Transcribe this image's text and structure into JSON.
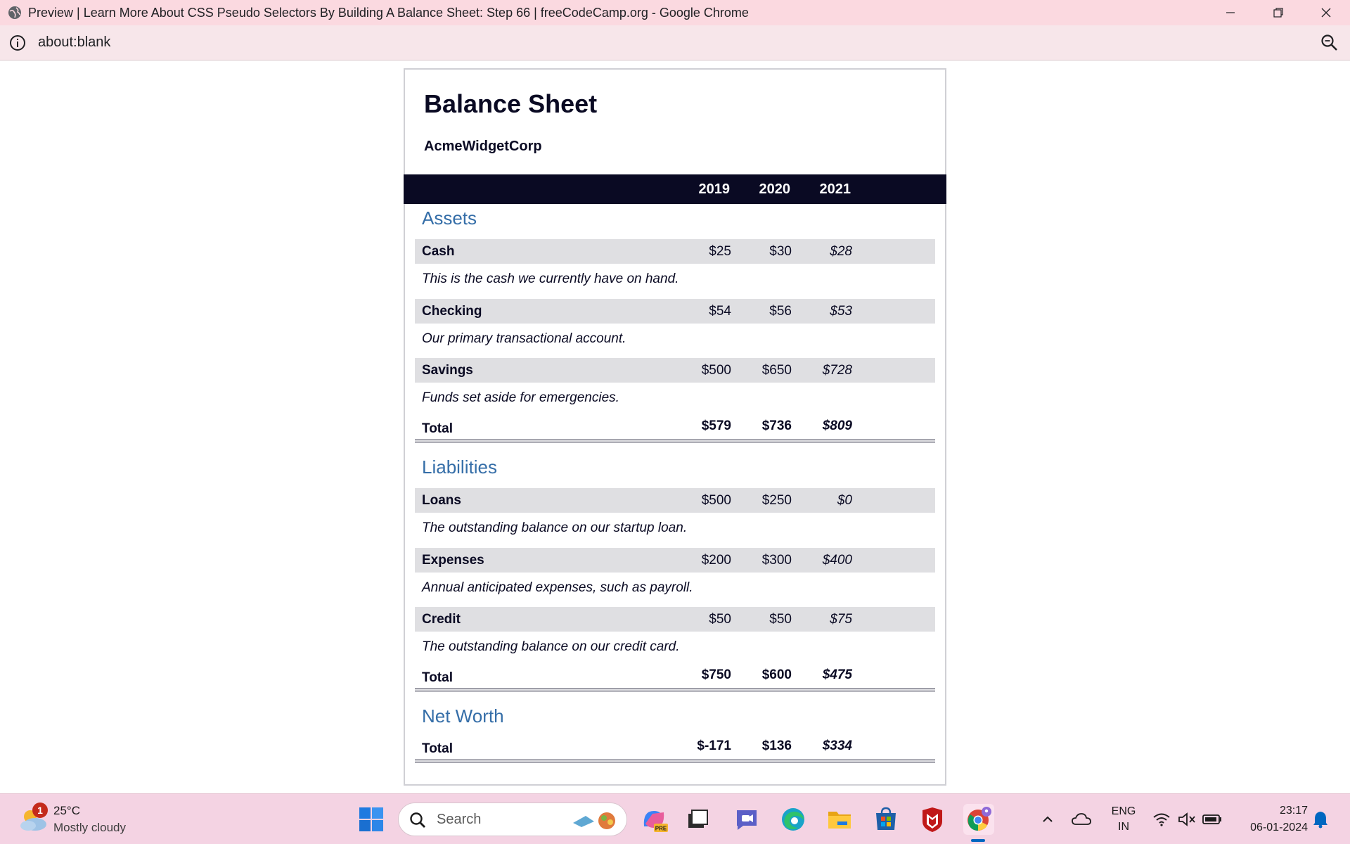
{
  "browser": {
    "window_title": "Preview | Learn More About CSS Pseudo Selectors By Building A Balance Sheet: Step 66 | freeCodeCamp.org - Google Chrome",
    "url": "about:blank"
  },
  "sheet": {
    "title": "Balance Sheet",
    "company": "AcmeWidgetCorp",
    "years": [
      "2019",
      "2020",
      "2021"
    ],
    "assets": {
      "heading": "Assets",
      "rows": [
        {
          "label": "Cash",
          "v2019": "$25",
          "v2020": "$30",
          "v2021": "$28",
          "desc": "This is the cash we currently have on hand."
        },
        {
          "label": "Checking",
          "v2019": "$54",
          "v2020": "$56",
          "v2021": "$53",
          "desc": "Our primary transactional account."
        },
        {
          "label": "Savings",
          "v2019": "$500",
          "v2020": "$650",
          "v2021": "$728",
          "desc": "Funds set aside for emergencies."
        }
      ],
      "total": {
        "label": "Total",
        "v2019": "$579",
        "v2020": "$736",
        "v2021": "$809"
      }
    },
    "liabilities": {
      "heading": "Liabilities",
      "rows": [
        {
          "label": "Loans",
          "v2019": "$500",
          "v2020": "$250",
          "v2021": "$0",
          "desc": "The outstanding balance on our startup loan."
        },
        {
          "label": "Expenses",
          "v2019": "$200",
          "v2020": "$300",
          "v2021": "$400",
          "desc": "Annual anticipated expenses, such as payroll."
        },
        {
          "label": "Credit",
          "v2019": "$50",
          "v2020": "$50",
          "v2021": "$75",
          "desc": "The outstanding balance on our credit card."
        }
      ],
      "total": {
        "label": "Total",
        "v2019": "$750",
        "v2020": "$600",
        "v2021": "$475"
      }
    },
    "net_worth": {
      "heading": "Net Worth",
      "total": {
        "label": "Total",
        "v2019": "$-171",
        "v2020": "$136",
        "v2021": "$334"
      }
    }
  },
  "taskbar": {
    "weather": {
      "temp": "25°C",
      "condition": "Mostly cloudy",
      "badge": "1"
    },
    "search_placeholder": "Search",
    "language": {
      "line1": "ENG",
      "line2": "IN"
    },
    "time": "23:17",
    "date": "06-01-2024"
  },
  "colors": {
    "titlebar": "#fbd9e0",
    "header_bg": "#0a0a23",
    "section_title": "#356ea8",
    "row_bg": "#dfdfe2",
    "taskbar": "#f4d3e3"
  }
}
